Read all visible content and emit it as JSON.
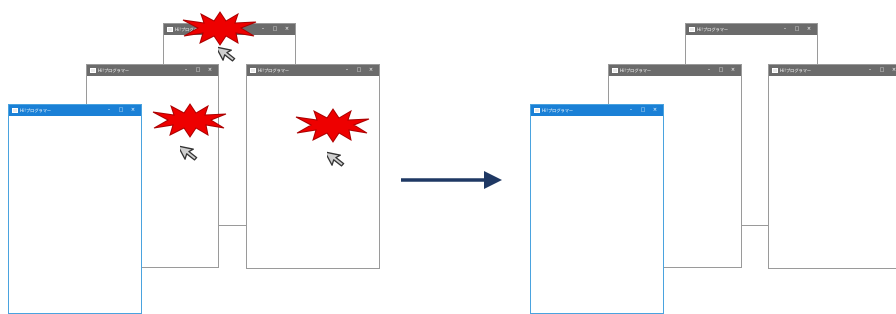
{
  "window_title": "Hi!プログラマー",
  "controls": {
    "minimize": "–",
    "maximize": "□",
    "close": "×"
  },
  "colors": {
    "inactive_titlebar": "#6b6b6b",
    "active_titlebar": "#1a80d6",
    "burst_fill": "#ee0000",
    "burst_stroke": "#aa0000",
    "arrow": "#1f3864"
  },
  "icons": [
    "window-app-icon",
    "explosion-burst-icon",
    "mouse-cursor-icon",
    "right-arrow-icon"
  ]
}
